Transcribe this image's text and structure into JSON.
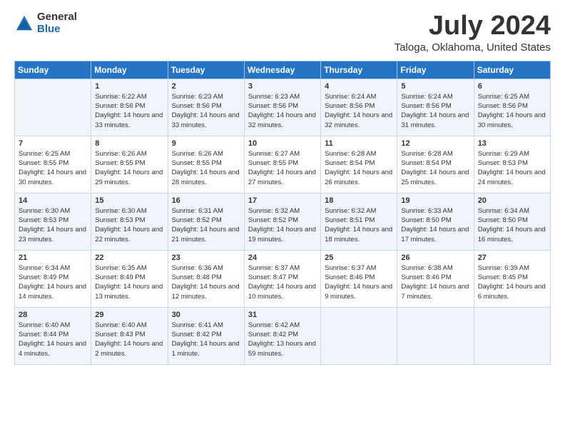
{
  "logo": {
    "general": "General",
    "blue": "Blue"
  },
  "header": {
    "month": "July 2024",
    "location": "Taloga, Oklahoma, United States"
  },
  "days_of_week": [
    "Sunday",
    "Monday",
    "Tuesday",
    "Wednesday",
    "Thursday",
    "Friday",
    "Saturday"
  ],
  "weeks": [
    [
      {
        "day": "",
        "sunrise": "",
        "sunset": "",
        "daylight": ""
      },
      {
        "day": "1",
        "sunrise": "Sunrise: 6:22 AM",
        "sunset": "Sunset: 8:56 PM",
        "daylight": "Daylight: 14 hours and 33 minutes."
      },
      {
        "day": "2",
        "sunrise": "Sunrise: 6:23 AM",
        "sunset": "Sunset: 8:56 PM",
        "daylight": "Daylight: 14 hours and 33 minutes."
      },
      {
        "day": "3",
        "sunrise": "Sunrise: 6:23 AM",
        "sunset": "Sunset: 8:56 PM",
        "daylight": "Daylight: 14 hours and 32 minutes."
      },
      {
        "day": "4",
        "sunrise": "Sunrise: 6:24 AM",
        "sunset": "Sunset: 8:56 PM",
        "daylight": "Daylight: 14 hours and 32 minutes."
      },
      {
        "day": "5",
        "sunrise": "Sunrise: 6:24 AM",
        "sunset": "Sunset: 8:56 PM",
        "daylight": "Daylight: 14 hours and 31 minutes."
      },
      {
        "day": "6",
        "sunrise": "Sunrise: 6:25 AM",
        "sunset": "Sunset: 8:56 PM",
        "daylight": "Daylight: 14 hours and 30 minutes."
      }
    ],
    [
      {
        "day": "7",
        "sunrise": "Sunrise: 6:25 AM",
        "sunset": "Sunset: 8:55 PM",
        "daylight": "Daylight: 14 hours and 30 minutes."
      },
      {
        "day": "8",
        "sunrise": "Sunrise: 6:26 AM",
        "sunset": "Sunset: 8:55 PM",
        "daylight": "Daylight: 14 hours and 29 minutes."
      },
      {
        "day": "9",
        "sunrise": "Sunrise: 6:26 AM",
        "sunset": "Sunset: 8:55 PM",
        "daylight": "Daylight: 14 hours and 28 minutes."
      },
      {
        "day": "10",
        "sunrise": "Sunrise: 6:27 AM",
        "sunset": "Sunset: 8:55 PM",
        "daylight": "Daylight: 14 hours and 27 minutes."
      },
      {
        "day": "11",
        "sunrise": "Sunrise: 6:28 AM",
        "sunset": "Sunset: 8:54 PM",
        "daylight": "Daylight: 14 hours and 26 minutes."
      },
      {
        "day": "12",
        "sunrise": "Sunrise: 6:28 AM",
        "sunset": "Sunset: 8:54 PM",
        "daylight": "Daylight: 14 hours and 25 minutes."
      },
      {
        "day": "13",
        "sunrise": "Sunrise: 6:29 AM",
        "sunset": "Sunset: 8:53 PM",
        "daylight": "Daylight: 14 hours and 24 minutes."
      }
    ],
    [
      {
        "day": "14",
        "sunrise": "Sunrise: 6:30 AM",
        "sunset": "Sunset: 8:53 PM",
        "daylight": "Daylight: 14 hours and 23 minutes."
      },
      {
        "day": "15",
        "sunrise": "Sunrise: 6:30 AM",
        "sunset": "Sunset: 8:53 PM",
        "daylight": "Daylight: 14 hours and 22 minutes."
      },
      {
        "day": "16",
        "sunrise": "Sunrise: 6:31 AM",
        "sunset": "Sunset: 8:52 PM",
        "daylight": "Daylight: 14 hours and 21 minutes."
      },
      {
        "day": "17",
        "sunrise": "Sunrise: 6:32 AM",
        "sunset": "Sunset: 8:52 PM",
        "daylight": "Daylight: 14 hours and 19 minutes."
      },
      {
        "day": "18",
        "sunrise": "Sunrise: 6:32 AM",
        "sunset": "Sunset: 8:51 PM",
        "daylight": "Daylight: 14 hours and 18 minutes."
      },
      {
        "day": "19",
        "sunrise": "Sunrise: 6:33 AM",
        "sunset": "Sunset: 8:50 PM",
        "daylight": "Daylight: 14 hours and 17 minutes."
      },
      {
        "day": "20",
        "sunrise": "Sunrise: 6:34 AM",
        "sunset": "Sunset: 8:50 PM",
        "daylight": "Daylight: 14 hours and 16 minutes."
      }
    ],
    [
      {
        "day": "21",
        "sunrise": "Sunrise: 6:34 AM",
        "sunset": "Sunset: 8:49 PM",
        "daylight": "Daylight: 14 hours and 14 minutes."
      },
      {
        "day": "22",
        "sunrise": "Sunrise: 6:35 AM",
        "sunset": "Sunset: 8:49 PM",
        "daylight": "Daylight: 14 hours and 13 minutes."
      },
      {
        "day": "23",
        "sunrise": "Sunrise: 6:36 AM",
        "sunset": "Sunset: 8:48 PM",
        "daylight": "Daylight: 14 hours and 12 minutes."
      },
      {
        "day": "24",
        "sunrise": "Sunrise: 6:37 AM",
        "sunset": "Sunset: 8:47 PM",
        "daylight": "Daylight: 14 hours and 10 minutes."
      },
      {
        "day": "25",
        "sunrise": "Sunrise: 6:37 AM",
        "sunset": "Sunset: 8:46 PM",
        "daylight": "Daylight: 14 hours and 9 minutes."
      },
      {
        "day": "26",
        "sunrise": "Sunrise: 6:38 AM",
        "sunset": "Sunset: 8:46 PM",
        "daylight": "Daylight: 14 hours and 7 minutes."
      },
      {
        "day": "27",
        "sunrise": "Sunrise: 6:39 AM",
        "sunset": "Sunset: 8:45 PM",
        "daylight": "Daylight: 14 hours and 6 minutes."
      }
    ],
    [
      {
        "day": "28",
        "sunrise": "Sunrise: 6:40 AM",
        "sunset": "Sunset: 8:44 PM",
        "daylight": "Daylight: 14 hours and 4 minutes."
      },
      {
        "day": "29",
        "sunrise": "Sunrise: 6:40 AM",
        "sunset": "Sunset: 8:43 PM",
        "daylight": "Daylight: 14 hours and 2 minutes."
      },
      {
        "day": "30",
        "sunrise": "Sunrise: 6:41 AM",
        "sunset": "Sunset: 8:42 PM",
        "daylight": "Daylight: 14 hours and 1 minute."
      },
      {
        "day": "31",
        "sunrise": "Sunrise: 6:42 AM",
        "sunset": "Sunset: 8:42 PM",
        "daylight": "Daylight: 13 hours and 59 minutes."
      },
      {
        "day": "",
        "sunrise": "",
        "sunset": "",
        "daylight": ""
      },
      {
        "day": "",
        "sunrise": "",
        "sunset": "",
        "daylight": ""
      },
      {
        "day": "",
        "sunrise": "",
        "sunset": "",
        "daylight": ""
      }
    ]
  ]
}
